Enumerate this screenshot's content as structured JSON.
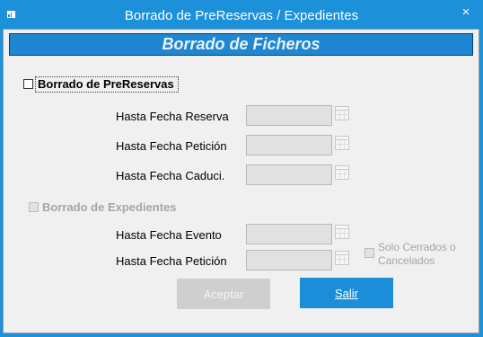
{
  "window": {
    "title": "Borrado de PreReservas / Expedientes",
    "close_glyph": "×",
    "colors": {
      "titlebar": "#1c90d8",
      "banner": "#1f87d2",
      "button_primary": "#1c8ed9"
    }
  },
  "header": {
    "title": "Borrado de Ficheros"
  },
  "prereservas": {
    "checkbox_label": "Borrado de PreReservas",
    "checked": false,
    "fields": [
      {
        "label": "Hasta Fecha Reserva",
        "value": ""
      },
      {
        "label": "Hasta Fecha Petición",
        "value": ""
      },
      {
        "label": "Hasta Fecha Caduci.",
        "value": ""
      }
    ]
  },
  "expedientes": {
    "checkbox_label": "Borrado de Expedientes",
    "checked": false,
    "enabled": false,
    "fields": [
      {
        "label": "Hasta Fecha Evento",
        "value": ""
      },
      {
        "label": "Hasta Fecha Petición",
        "value": ""
      }
    ],
    "solo_cerrados_label": "Solo Cerrados o Cancelados"
  },
  "buttons": {
    "aceptar": {
      "label": "Aceptar",
      "enabled": false
    },
    "salir": {
      "label": "Salir",
      "enabled": true
    }
  },
  "icons": {
    "calendar": "calendar-icon",
    "app": "app-icon",
    "close": "close-icon"
  }
}
